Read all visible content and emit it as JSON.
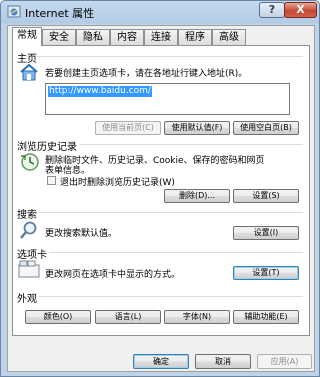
{
  "window": {
    "title": "Internet 属性",
    "help_label": "?",
    "close_label": "X"
  },
  "tabs": [
    "常规",
    "安全",
    "隐私",
    "内容",
    "连接",
    "程序",
    "高级"
  ],
  "homepage": {
    "section_title": "主页",
    "description": "若要创建主页选项卡，请在各地址行键入地址(R)。",
    "url": "http://www.baidu.com/",
    "use_current": "使用当前页(C)",
    "use_default": "使用默认值(F)",
    "use_blank": "使用空白页(B)"
  },
  "history": {
    "section_title": "浏览历史记录",
    "description_line1": "删除临时文件、历史记录、Cookie、保存的密码和网页",
    "description_line2": "表单信息。",
    "checkbox_label": "退出时删除浏览历史记录(W)",
    "delete_label": "删除(D)...",
    "settings_label": "设置(S)"
  },
  "search": {
    "section_title": "搜索",
    "description": "更改搜索默认值。",
    "settings_label": "设置(I)"
  },
  "tabs_section": {
    "section_title": "选项卡",
    "description": "更改网页在选项卡中显示的方式。",
    "settings_label": "设置(T)"
  },
  "appearance": {
    "section_title": "外观",
    "colors": "颜色(O)",
    "languages": "语言(L)",
    "fonts": "字体(N)",
    "accessibility": "辅助功能(E)"
  },
  "dialog": {
    "ok": "确定",
    "cancel": "取消",
    "apply": "应用(A)"
  }
}
